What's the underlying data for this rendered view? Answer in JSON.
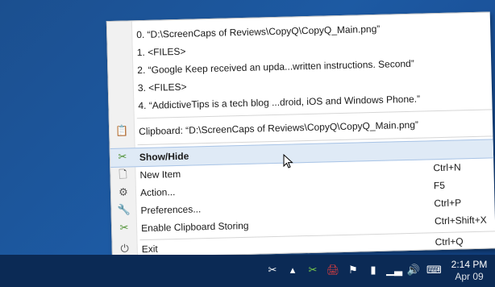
{
  "history": [
    "0. “D:\\ScreenCaps of Reviews\\CopyQ\\CopyQ_Main.png”",
    "1. <FILES>",
    "2. “Google Keep received an upda...written instructions. Second”",
    "3. <FILES>",
    "4. “AddictiveTips is a tech blog ...droid, iOS and Windows Phone.”"
  ],
  "clipboard": {
    "icon": "clipboard-icon",
    "label": "Clipboard: “D:\\ScreenCaps of Reviews\\CopyQ\\CopyQ_Main.png”"
  },
  "menu_items": [
    {
      "icon": "copyq-icon",
      "label": "Show/Hide",
      "shortcut": ""
    },
    {
      "icon": "new-item-icon",
      "label": "New Item",
      "shortcut": "Ctrl+N"
    },
    {
      "icon": "gear-icon",
      "label": "Action...",
      "shortcut": "F5"
    },
    {
      "icon": "wrench-icon",
      "label": "Preferences...",
      "shortcut": "Ctrl+P"
    },
    {
      "icon": "copyq-icon",
      "label": "Enable Clipboard Storing",
      "shortcut": "Ctrl+Shift+X"
    }
  ],
  "exit": {
    "icon": "power-icon",
    "label": "Exit",
    "shortcut": "Ctrl+Q"
  },
  "taskbar": {
    "time": "2:14 PM",
    "date": "Apr 09",
    "tray_icons": [
      "copyq-icon",
      "chevron-up-icon",
      "printer-icon",
      "flag-icon",
      "battery-icon",
      "signal-icon",
      "speaker-icon",
      "keyboard-icon"
    ]
  }
}
